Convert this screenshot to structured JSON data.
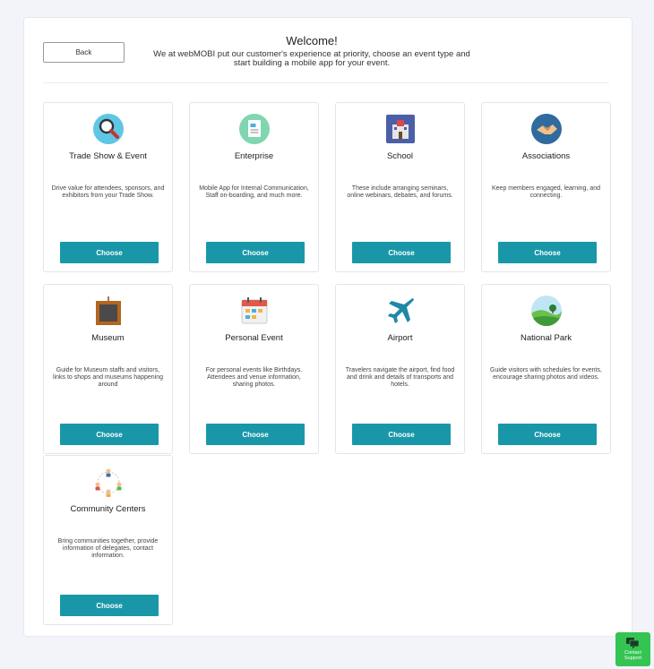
{
  "header": {
    "back_label": "Back",
    "title": "Welcome!",
    "subtitle": "We at webMOBI put our customer's experience at priority, choose an event type and start building a mobile app for your event."
  },
  "cards": [
    {
      "title": "Trade Show & Event",
      "desc": "Drive value for attendees, sponsors, and exhibitors from your Trade Show.",
      "button": "Choose",
      "icon": "magnifier-icon"
    },
    {
      "title": "Enterprise",
      "desc": "Mobile App for Internal Communication, Staff on-boarding, and much more.",
      "button": "Choose",
      "icon": "document-icon"
    },
    {
      "title": "School",
      "desc": "These include arranging seminars, online webinars, debates, and forums.",
      "button": "Choose",
      "icon": "school-building-icon"
    },
    {
      "title": "Associations",
      "desc": "Keep members engaged, learning, and connecting.",
      "button": "Choose",
      "icon": "handshake-icon"
    },
    {
      "title": "Museum",
      "desc": "Guide for Museum staffs and visitors, links to shops and museums happening around",
      "button": "Choose",
      "icon": "picture-frame-icon"
    },
    {
      "title": "Personal Event",
      "desc": "For personal events like Birthdays. Attendees and venue information, sharing photos.",
      "button": "Choose",
      "icon": "calendar-icon"
    },
    {
      "title": "Airport",
      "desc": "Travelers navigate the airport, find food and drink and details of transports and hotels.",
      "button": "Choose",
      "icon": "airplane-icon"
    },
    {
      "title": "National Park",
      "desc": "Guide visitors with schedules for events, encourage sharing photos and videos.",
      "button": "Choose",
      "icon": "park-landscape-icon"
    },
    {
      "title": "Community Centers",
      "desc": "Bring communities together, provide information of delegates, contact information.",
      "button": "Choose",
      "icon": "community-people-icon"
    }
  ],
  "support": {
    "label": "Contact Support",
    "icon": "chat-bubbles-icon"
  },
  "colors": {
    "accent": "#1997a8",
    "support": "#33c452"
  }
}
